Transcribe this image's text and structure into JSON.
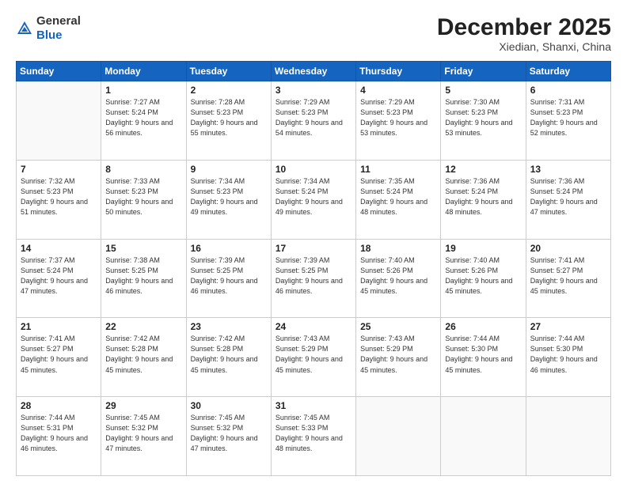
{
  "header": {
    "logo_general": "General",
    "logo_blue": "Blue",
    "month_title": "December 2025",
    "location": "Xiedian, Shanxi, China"
  },
  "days_of_week": [
    "Sunday",
    "Monday",
    "Tuesday",
    "Wednesday",
    "Thursday",
    "Friday",
    "Saturday"
  ],
  "weeks": [
    [
      {
        "day": "",
        "sunrise": "",
        "sunset": "",
        "daylight": ""
      },
      {
        "day": "1",
        "sunrise": "Sunrise: 7:27 AM",
        "sunset": "Sunset: 5:24 PM",
        "daylight": "Daylight: 9 hours and 56 minutes."
      },
      {
        "day": "2",
        "sunrise": "Sunrise: 7:28 AM",
        "sunset": "Sunset: 5:23 PM",
        "daylight": "Daylight: 9 hours and 55 minutes."
      },
      {
        "day": "3",
        "sunrise": "Sunrise: 7:29 AM",
        "sunset": "Sunset: 5:23 PM",
        "daylight": "Daylight: 9 hours and 54 minutes."
      },
      {
        "day": "4",
        "sunrise": "Sunrise: 7:29 AM",
        "sunset": "Sunset: 5:23 PM",
        "daylight": "Daylight: 9 hours and 53 minutes."
      },
      {
        "day": "5",
        "sunrise": "Sunrise: 7:30 AM",
        "sunset": "Sunset: 5:23 PM",
        "daylight": "Daylight: 9 hours and 53 minutes."
      },
      {
        "day": "6",
        "sunrise": "Sunrise: 7:31 AM",
        "sunset": "Sunset: 5:23 PM",
        "daylight": "Daylight: 9 hours and 52 minutes."
      }
    ],
    [
      {
        "day": "7",
        "sunrise": "Sunrise: 7:32 AM",
        "sunset": "Sunset: 5:23 PM",
        "daylight": "Daylight: 9 hours and 51 minutes."
      },
      {
        "day": "8",
        "sunrise": "Sunrise: 7:33 AM",
        "sunset": "Sunset: 5:23 PM",
        "daylight": "Daylight: 9 hours and 50 minutes."
      },
      {
        "day": "9",
        "sunrise": "Sunrise: 7:34 AM",
        "sunset": "Sunset: 5:23 PM",
        "daylight": "Daylight: 9 hours and 49 minutes."
      },
      {
        "day": "10",
        "sunrise": "Sunrise: 7:34 AM",
        "sunset": "Sunset: 5:24 PM",
        "daylight": "Daylight: 9 hours and 49 minutes."
      },
      {
        "day": "11",
        "sunrise": "Sunrise: 7:35 AM",
        "sunset": "Sunset: 5:24 PM",
        "daylight": "Daylight: 9 hours and 48 minutes."
      },
      {
        "day": "12",
        "sunrise": "Sunrise: 7:36 AM",
        "sunset": "Sunset: 5:24 PM",
        "daylight": "Daylight: 9 hours and 48 minutes."
      },
      {
        "day": "13",
        "sunrise": "Sunrise: 7:36 AM",
        "sunset": "Sunset: 5:24 PM",
        "daylight": "Daylight: 9 hours and 47 minutes."
      }
    ],
    [
      {
        "day": "14",
        "sunrise": "Sunrise: 7:37 AM",
        "sunset": "Sunset: 5:24 PM",
        "daylight": "Daylight: 9 hours and 47 minutes."
      },
      {
        "day": "15",
        "sunrise": "Sunrise: 7:38 AM",
        "sunset": "Sunset: 5:25 PM",
        "daylight": "Daylight: 9 hours and 46 minutes."
      },
      {
        "day": "16",
        "sunrise": "Sunrise: 7:39 AM",
        "sunset": "Sunset: 5:25 PM",
        "daylight": "Daylight: 9 hours and 46 minutes."
      },
      {
        "day": "17",
        "sunrise": "Sunrise: 7:39 AM",
        "sunset": "Sunset: 5:25 PM",
        "daylight": "Daylight: 9 hours and 46 minutes."
      },
      {
        "day": "18",
        "sunrise": "Sunrise: 7:40 AM",
        "sunset": "Sunset: 5:26 PM",
        "daylight": "Daylight: 9 hours and 45 minutes."
      },
      {
        "day": "19",
        "sunrise": "Sunrise: 7:40 AM",
        "sunset": "Sunset: 5:26 PM",
        "daylight": "Daylight: 9 hours and 45 minutes."
      },
      {
        "day": "20",
        "sunrise": "Sunrise: 7:41 AM",
        "sunset": "Sunset: 5:27 PM",
        "daylight": "Daylight: 9 hours and 45 minutes."
      }
    ],
    [
      {
        "day": "21",
        "sunrise": "Sunrise: 7:41 AM",
        "sunset": "Sunset: 5:27 PM",
        "daylight": "Daylight: 9 hours and 45 minutes."
      },
      {
        "day": "22",
        "sunrise": "Sunrise: 7:42 AM",
        "sunset": "Sunset: 5:28 PM",
        "daylight": "Daylight: 9 hours and 45 minutes."
      },
      {
        "day": "23",
        "sunrise": "Sunrise: 7:42 AM",
        "sunset": "Sunset: 5:28 PM",
        "daylight": "Daylight: 9 hours and 45 minutes."
      },
      {
        "day": "24",
        "sunrise": "Sunrise: 7:43 AM",
        "sunset": "Sunset: 5:29 PM",
        "daylight": "Daylight: 9 hours and 45 minutes."
      },
      {
        "day": "25",
        "sunrise": "Sunrise: 7:43 AM",
        "sunset": "Sunset: 5:29 PM",
        "daylight": "Daylight: 9 hours and 45 minutes."
      },
      {
        "day": "26",
        "sunrise": "Sunrise: 7:44 AM",
        "sunset": "Sunset: 5:30 PM",
        "daylight": "Daylight: 9 hours and 45 minutes."
      },
      {
        "day": "27",
        "sunrise": "Sunrise: 7:44 AM",
        "sunset": "Sunset: 5:30 PM",
        "daylight": "Daylight: 9 hours and 46 minutes."
      }
    ],
    [
      {
        "day": "28",
        "sunrise": "Sunrise: 7:44 AM",
        "sunset": "Sunset: 5:31 PM",
        "daylight": "Daylight: 9 hours and 46 minutes."
      },
      {
        "day": "29",
        "sunrise": "Sunrise: 7:45 AM",
        "sunset": "Sunset: 5:32 PM",
        "daylight": "Daylight: 9 hours and 47 minutes."
      },
      {
        "day": "30",
        "sunrise": "Sunrise: 7:45 AM",
        "sunset": "Sunset: 5:32 PM",
        "daylight": "Daylight: 9 hours and 47 minutes."
      },
      {
        "day": "31",
        "sunrise": "Sunrise: 7:45 AM",
        "sunset": "Sunset: 5:33 PM",
        "daylight": "Daylight: 9 hours and 48 minutes."
      },
      {
        "day": "",
        "sunrise": "",
        "sunset": "",
        "daylight": ""
      },
      {
        "day": "",
        "sunrise": "",
        "sunset": "",
        "daylight": ""
      },
      {
        "day": "",
        "sunrise": "",
        "sunset": "",
        "daylight": ""
      }
    ]
  ]
}
